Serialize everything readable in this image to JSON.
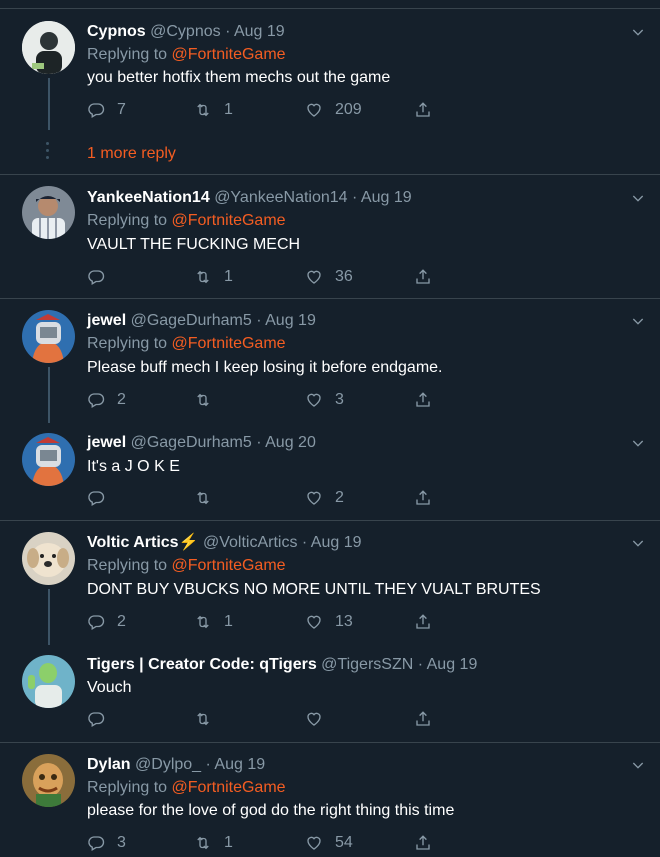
{
  "reply_prefix": "Replying to",
  "reply_target": "@FortniteGame",
  "tweets": [
    {
      "name": "Cypnos",
      "handle": "@Cypnos",
      "date": "· Aug 19",
      "text": "you better hotfix them mechs out the game",
      "replies": "7",
      "retweets": "1",
      "likes": "209",
      "more_replies": "1 more reply"
    },
    {
      "name": "YankeeNation14",
      "handle": "@YankeeNation14",
      "date": "· Aug 19",
      "text": "VAULT THE FUCKING MECH",
      "replies": "",
      "retweets": "1",
      "likes": "36"
    },
    {
      "name": "jewel",
      "handle": "@GageDurham5",
      "date": "· Aug 19",
      "text": "Please buff mech I keep losing it before endgame.",
      "replies": "2",
      "retweets": "",
      "likes": "3"
    },
    {
      "name": "jewel",
      "handle": "@GageDurham5",
      "date": "· Aug 20",
      "text": "It's a J O K E",
      "replies": "",
      "retweets": "",
      "likes": "2"
    },
    {
      "name": "Voltic Artics⚡",
      "handle": "@VolticArtics",
      "date": "· Aug 19",
      "text": "DONT BUY VBUCKS NO MORE UNTIL THEY VUALT BRUTES",
      "replies": "2",
      "retweets": "1",
      "likes": "13"
    },
    {
      "name": "Tigers | Creator Code: qTigers",
      "handle": "@TigersSZN",
      "date": "· Aug 19",
      "text": "Vouch",
      "replies": "",
      "retweets": "",
      "likes": ""
    },
    {
      "name": "Dylan",
      "handle": "@Dylpo_",
      "date": "· Aug 19",
      "text": "please for the love of god do the right thing this time",
      "replies": "3",
      "retweets": "1",
      "likes": "54"
    }
  ],
  "colors": {
    "background": "#15202b",
    "border": "#38444d",
    "muted": "#8899a6",
    "link": "#f45d22"
  }
}
